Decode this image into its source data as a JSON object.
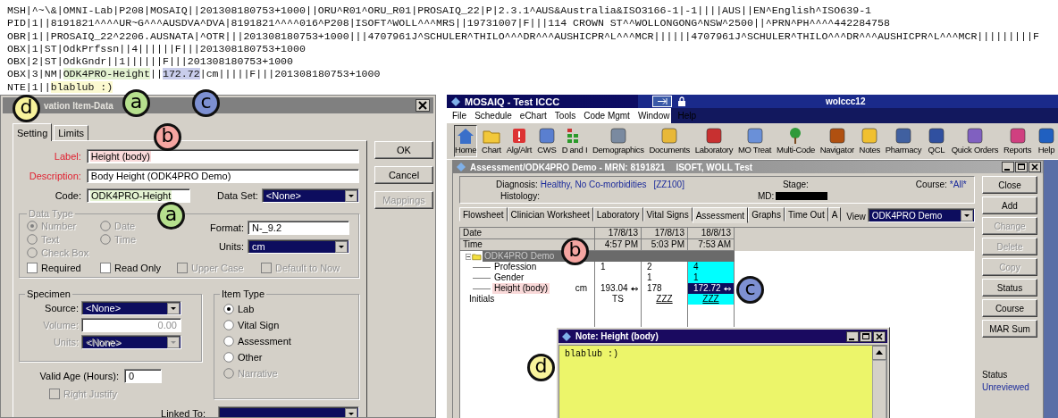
{
  "hl7_message": {
    "lines": [
      {
        "segments": [
          {
            "text": "MSH|^~\\&|OMNI-Lab|P208|MOSAIQ||201308180753+1000||ORU^R01^ORU_R01|PROSAIQ_22|P|2.3.1^AUS&Australia&ISO3166-1|-1||||AUS||EN^English^ISO639-1"
          }
        ]
      },
      {
        "segments": [
          {
            "text": "PID|1||8191821^^^^UR~G^^^AUSDVA^DVA|8191821^^^^016^P208|ISOFT^WOLL^^^MRS||19731007|F|||114 CROWN ST^^WOLLONGONG^NSW^2500||^PRN^PH^^^^442284758"
          }
        ]
      },
      {
        "segments": [
          {
            "text": "OBR|1||PROSAIQ_22^2206.AUSNATA|^OTR|||201308180753+1000|||4707961J^SCHULER^THILO^^^DR^^^AUSHICPR^L^^^MCR||||||4707961J^SCHULER^THILO^^^DR^^^AUSHICPR^L^^^MCR|||||||||F"
          }
        ]
      },
      {
        "segments": [
          {
            "text": "OBX|1|ST|OdkPrfssn||4||||||F|||201308180753+1000"
          }
        ]
      },
      {
        "segments": [
          {
            "text": "OBX|2|ST|OdkGndr||1||||||F|||201308180753+1000"
          }
        ]
      },
      {
        "segments": [
          {
            "text": "OBX|3|NM|"
          },
          {
            "text": "ODK4PRO-Height",
            "color": "#e4f3d2"
          },
          {
            "text": "||"
          },
          {
            "text": "172.72",
            "color": "#c9cdeb"
          },
          {
            "text": "|cm|||||F|||201308180753+1000"
          }
        ]
      },
      {
        "segments": [
          {
            "text": "NTE|1||"
          },
          {
            "text": "blablub :)",
            "color": "#fbf9d0"
          }
        ]
      }
    ]
  },
  "callouts": [
    {
      "letter": "d",
      "color": "#f8f39c"
    },
    {
      "letter": "a",
      "color": "#b6e08e"
    },
    {
      "letter": "c",
      "color": "#7d90d2"
    },
    {
      "letter": "b",
      "color": "#f5a5a1"
    },
    {
      "letter": "a",
      "color": "#b6e08e"
    },
    {
      "letter": "b",
      "color": "#f5a5a1"
    },
    {
      "letter": "c",
      "color": "#7d90d2"
    },
    {
      "letter": "d",
      "color": "#f8f39c"
    }
  ],
  "dialog": {
    "title": "vation Item-Data",
    "tabs": [
      {
        "label": "Setting",
        "selected": true
      },
      {
        "label": "Limits",
        "selected": false
      }
    ],
    "text_fields": [
      {
        "label": "Label:",
        "value": "Height (body)",
        "required": true,
        "color": "#f9d9d9"
      },
      {
        "label": "Description:",
        "value": "Body Height (ODK4PRO Demo)",
        "required": true
      }
    ],
    "code": {
      "label": "Code:",
      "value": "ODK4PRO-Height",
      "color": "#e4f3d2"
    },
    "data_set": {
      "label": "Data Set:",
      "value": "<None>"
    },
    "data_type": {
      "legend": "Data Type",
      "radios": [
        {
          "label": "Number",
          "selected": true,
          "disabled": true
        },
        {
          "label": "Date",
          "selected": false,
          "disabled": true
        },
        {
          "label": "Text",
          "selected": false,
          "disabled": true
        },
        {
          "label": "Time",
          "selected": false,
          "disabled": true
        },
        {
          "label": "Check Box",
          "selected": false,
          "disabled": true
        }
      ],
      "format": {
        "label": "Format:",
        "value": "N-_9.2"
      },
      "units": {
        "label": "Units:",
        "value": "cm"
      }
    },
    "checkboxes": [
      {
        "label": "Required",
        "checked": false,
        "disabled": false
      },
      {
        "label": "Read Only",
        "checked": false,
        "disabled": false
      },
      {
        "label": "Upper Case",
        "checked": false,
        "disabled": true
      },
      {
        "label": "Default to Now",
        "checked": false,
        "disabled": true
      }
    ],
    "specimen": {
      "legend": "Specimen",
      "fields": [
        {
          "kind": "select",
          "label": "Source:",
          "value": "<None>",
          "disabled": false
        },
        {
          "kind": "input",
          "label": "Volume:",
          "value": "0.00",
          "disabled": true
        },
        {
          "kind": "select",
          "label": "Units:",
          "value": "<None>",
          "disabled": true
        }
      ]
    },
    "item_type": {
      "legend": "Item Type",
      "radios": [
        {
          "label": "Lab",
          "selected": true,
          "disabled": false
        },
        {
          "label": "Vital Sign",
          "selected": false,
          "disabled": false
        },
        {
          "label": "Assessment",
          "selected": false,
          "disabled": false
        },
        {
          "label": "Other",
          "selected": false,
          "disabled": false
        },
        {
          "label": "Narrative",
          "selected": false,
          "disabled": true
        }
      ]
    },
    "valid_age": {
      "label": "Valid Age (Hours):",
      "value": "0"
    },
    "right_justify": {
      "label": "Right Justify",
      "checked": false,
      "disabled": true
    },
    "linked_to": {
      "label": "Linked To:"
    },
    "buttons": [
      {
        "label": "OK",
        "disabled": false
      },
      {
        "label": "Cancel",
        "disabled": false
      },
      {
        "label": "Mappings",
        "disabled": true
      }
    ]
  },
  "app": {
    "title": "MOSAIQ - Test ICCC",
    "workstation": "wolccc12",
    "menu": [
      "File",
      "Schedule",
      "eChart",
      "Tools",
      "Code Mgmt",
      "Window",
      "Help"
    ],
    "toolbar": [
      {
        "label": "Home",
        "selected": true
      },
      {
        "label": "Chart",
        "selected": false
      },
      {
        "label": "Alg/Alrt",
        "selected": false
      },
      {
        "label": "CWS",
        "selected": false
      },
      {
        "label": "D and I",
        "selected": false
      },
      {
        "label": "Demographics",
        "selected": false
      },
      {
        "label": "Documents",
        "selected": false
      },
      {
        "label": "Laboratory",
        "selected": false
      },
      {
        "label": "MO Treat",
        "selected": false
      },
      {
        "label": "Multi-Code",
        "selected": false
      },
      {
        "label": "Navigator",
        "selected": false
      },
      {
        "label": "Notes",
        "selected": false
      },
      {
        "label": "Pharmacy",
        "selected": false
      },
      {
        "label": "QCL",
        "selected": false
      },
      {
        "label": "Quick Orders",
        "selected": false
      },
      {
        "label": "Reports",
        "selected": false
      },
      {
        "label": "Help",
        "selected": false
      }
    ],
    "window_title": "Assessment/ODK4PRO Demo - MRN: 8191821",
    "patient": "ISOFT, WOLL Test",
    "info": {
      "diagnosis_label": "Diagnosis:",
      "diagnosis": "Healthy, No Co-morbidities",
      "diagnosis_code": "[ZZ100]",
      "stage_label": "Stage:",
      "course_label": "Course:",
      "course": "*All*",
      "histology_label": "Histology:",
      "md_label": "MD:"
    },
    "tabs": [
      {
        "label": "Flowsheet",
        "selected": false
      },
      {
        "label": "Clinician Worksheet",
        "selected": false
      },
      {
        "label": "Laboratory",
        "selected": false
      },
      {
        "label": "Vital Signs",
        "selected": false
      },
      {
        "label": "Assessment",
        "selected": true
      },
      {
        "label": "Graphs",
        "selected": false
      },
      {
        "label": "Time Out",
        "selected": false
      },
      {
        "label": "A",
        "selected": false
      }
    ],
    "view": {
      "label": "View",
      "value": "ODK4PRO Demo"
    },
    "grid": {
      "header": [
        {
          "label": "Date",
          "values": [
            "17/8/13",
            "17/8/13",
            "18/8/13"
          ]
        },
        {
          "label": "Time",
          "values": [
            "4:57 PM",
            "5:03 PM",
            "7:53 AM"
          ]
        }
      ],
      "group": {
        "label": "ODK4PRO Demo",
        "expanded": true,
        "children": [
          {
            "label": "Profession",
            "cells": [
              {
                "text": "1",
                "highlighted": false
              },
              {
                "text": "2",
                "highlighted": false
              },
              {
                "text": "4",
                "highlighted": true
              }
            ]
          },
          {
            "label": "Gender",
            "cells": [
              {
                "highlighted": false
              },
              {
                "text": "1",
                "highlighted": false
              },
              {
                "text": "1",
                "highlighted": true
              }
            ]
          },
          {
            "label": "Height (body)",
            "unit": "cm",
            "color": "#f9d9d9",
            "cells": [
              {
                "text": "193.04",
                "linked": true,
                "highlighted": false
              },
              {
                "text": "178",
                "highlighted": false
              },
              {
                "text": "172.72",
                "linked": true,
                "selected": true,
                "highlighted": false
              }
            ]
          }
        ]
      },
      "rows": [
        {
          "label": "Initials",
          "cells": [
            {
              "text": "TS",
              "highlighted": false
            },
            {
              "text": "ZZZ",
              "underlined": true,
              "highlighted": false
            },
            {
              "text": "ZZZ",
              "underlined": true,
              "highlighted": true
            }
          ]
        }
      ]
    },
    "side_buttons": [
      {
        "label": "Close",
        "disabled": false
      },
      {
        "label": "Add",
        "disabled": false
      },
      {
        "label": "Change",
        "disabled": true
      },
      {
        "label": "Delete",
        "disabled": true
      },
      {
        "label": "Copy",
        "disabled": true
      },
      {
        "label": "Status",
        "disabled": false
      },
      {
        "label": "Course",
        "disabled": false
      },
      {
        "label": "MAR Sum",
        "disabled": false
      }
    ],
    "status": {
      "label": "Status",
      "value": "Unreviewed"
    },
    "note": {
      "title": "Note: Height (body)",
      "text": "blablub :)"
    }
  }
}
